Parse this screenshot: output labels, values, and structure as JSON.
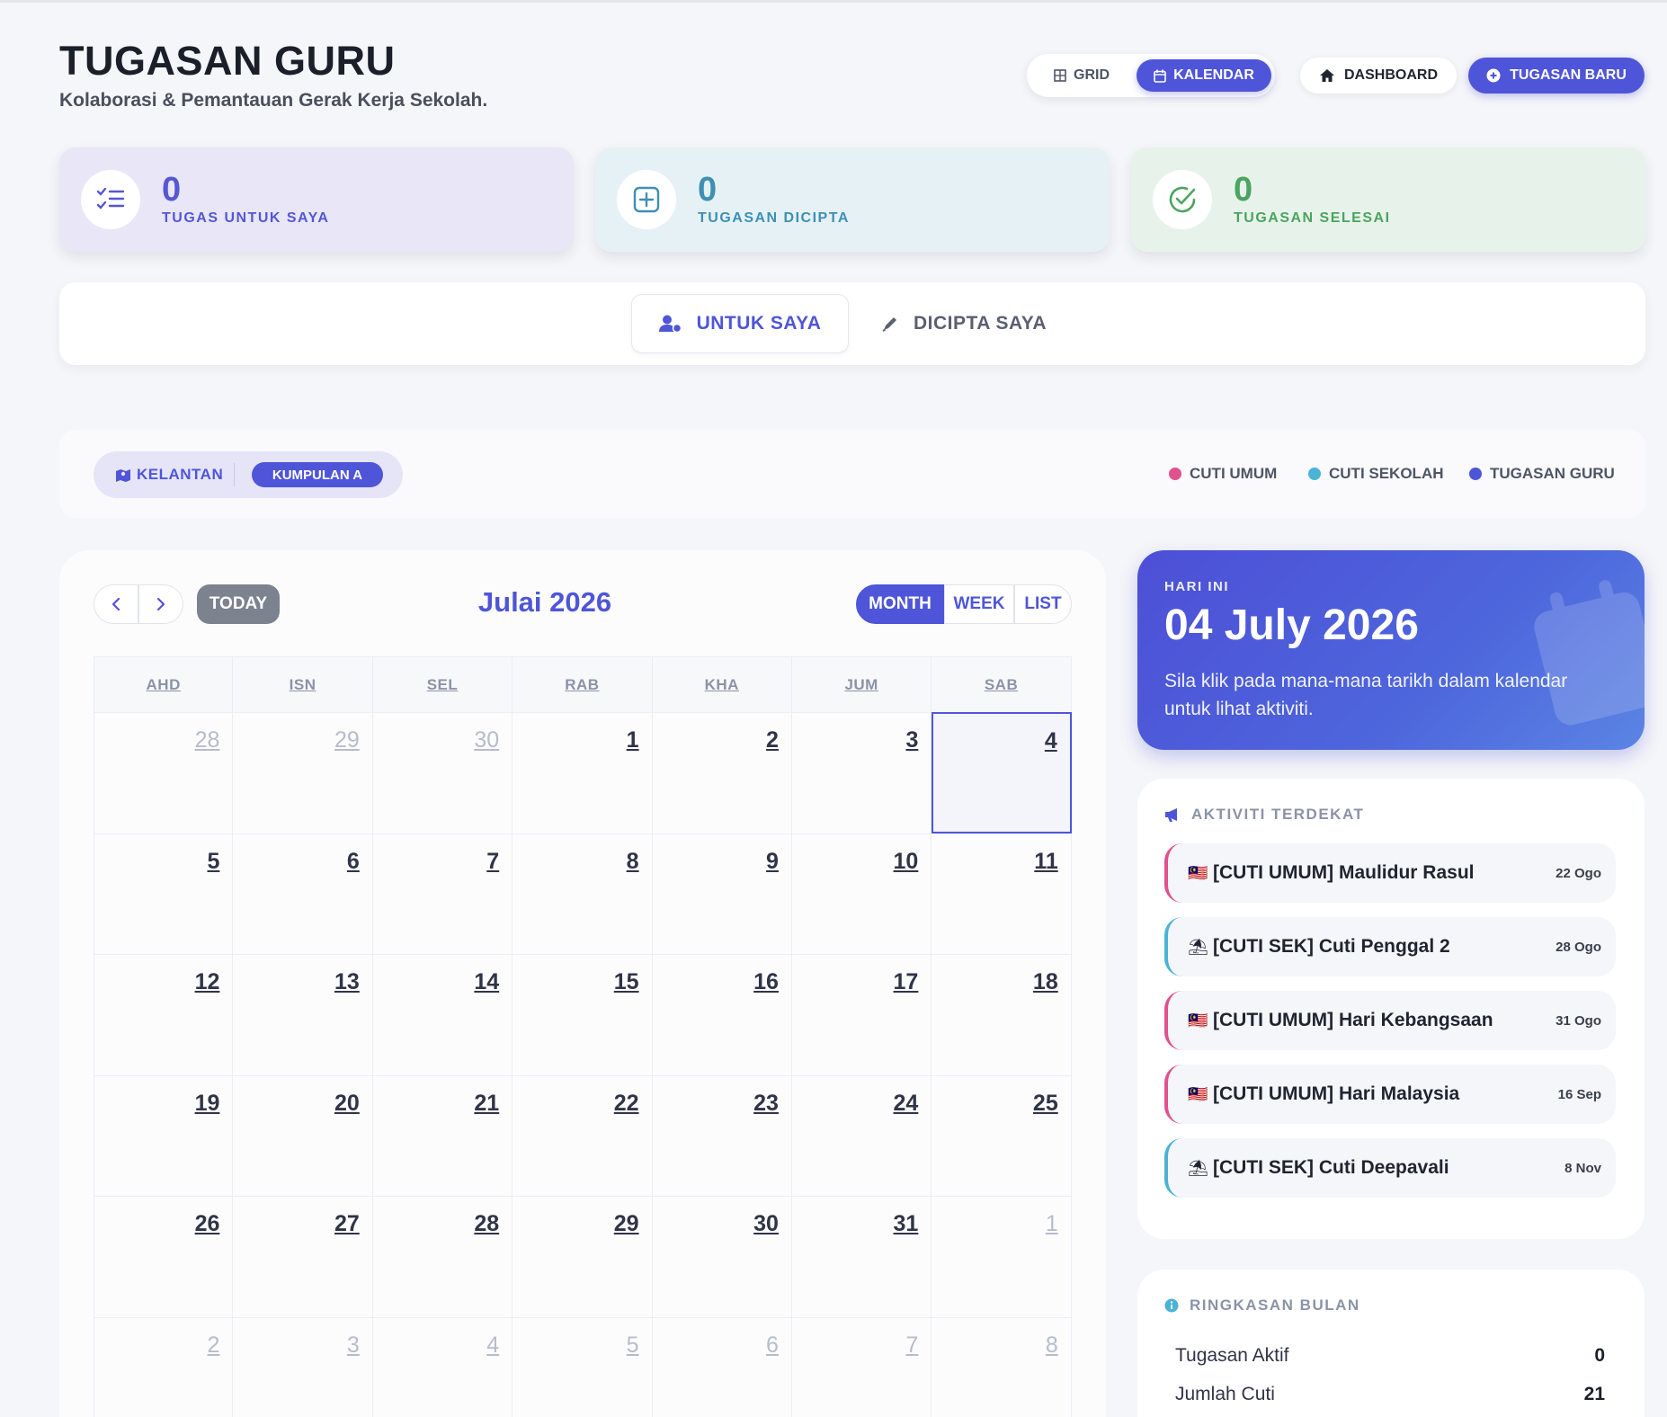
{
  "header": {
    "title": "TUGASAN GURU",
    "subtitle": "Kolaborasi & Pemantauan Gerak Kerja Sekolah.",
    "view_grid": "GRID",
    "view_calendar": "KALENDAR",
    "dashboard": "DASHBOARD",
    "new_task": "TUGASAN BARU"
  },
  "stats": [
    {
      "value": "0",
      "label": "TUGAS UNTUK SAYA",
      "icon": "checklist-icon",
      "color": "#5557d4"
    },
    {
      "value": "0",
      "label": "TUGASAN DICIPTA",
      "icon": "plus-square-icon",
      "color": "#3d90b3"
    },
    {
      "value": "0",
      "label": "TUGASAN SELESAI",
      "icon": "check-circle-icon",
      "color": "#4ba45f"
    }
  ],
  "tabs": [
    {
      "label": "UNTUK SAYA",
      "icon": "user-icon",
      "active": true
    },
    {
      "label": "DICIPTA SAYA",
      "icon": "pen-icon",
      "active": false
    }
  ],
  "filter": {
    "state": "KELANTAN",
    "group": "KUMPULAN A"
  },
  "legend": [
    {
      "label": "CUTI UMUM",
      "color": "#e2508f"
    },
    {
      "label": "CUTI SEKOLAH",
      "color": "#4ab3d6"
    },
    {
      "label": "TUGASAN GURU",
      "color": "#4f55d8"
    }
  ],
  "calendar": {
    "today_button": "TODAY",
    "title": "Julai 2026",
    "views": [
      "MONTH",
      "WEEK",
      "LIST"
    ],
    "weekdays": [
      "AHD",
      "ISN",
      "SEL",
      "RAB",
      "KHA",
      "JUM",
      "SAB"
    ],
    "weeks": [
      [
        {
          "d": "28",
          "o": true
        },
        {
          "d": "29",
          "o": true
        },
        {
          "d": "30",
          "o": true
        },
        {
          "d": "1"
        },
        {
          "d": "2"
        },
        {
          "d": "3"
        },
        {
          "d": "4",
          "t": true
        }
      ],
      [
        {
          "d": "5"
        },
        {
          "d": "6"
        },
        {
          "d": "7"
        },
        {
          "d": "8"
        },
        {
          "d": "9"
        },
        {
          "d": "10"
        },
        {
          "d": "11"
        }
      ],
      [
        {
          "d": "12"
        },
        {
          "d": "13"
        },
        {
          "d": "14"
        },
        {
          "d": "15"
        },
        {
          "d": "16"
        },
        {
          "d": "17"
        },
        {
          "d": "18"
        }
      ],
      [
        {
          "d": "19"
        },
        {
          "d": "20"
        },
        {
          "d": "21"
        },
        {
          "d": "22"
        },
        {
          "d": "23"
        },
        {
          "d": "24"
        },
        {
          "d": "25"
        }
      ],
      [
        {
          "d": "26"
        },
        {
          "d": "27"
        },
        {
          "d": "28"
        },
        {
          "d": "29"
        },
        {
          "d": "30"
        },
        {
          "d": "31"
        },
        {
          "d": "1",
          "o": true
        }
      ],
      [
        {
          "d": "2",
          "o": true
        },
        {
          "d": "3",
          "o": true
        },
        {
          "d": "4",
          "o": true
        },
        {
          "d": "5",
          "o": true
        },
        {
          "d": "6",
          "o": true
        },
        {
          "d": "7",
          "o": true
        },
        {
          "d": "8",
          "o": true
        }
      ]
    ]
  },
  "today_card": {
    "label": "HARI INI",
    "date": "04 July 2026",
    "description": "Sila klik pada mana-mana tarikh dalam kalendar untuk lihat aktiviti."
  },
  "activities": {
    "heading": "AKTIVITI TERDEKAT",
    "items": [
      {
        "title": "[CUTI UMUM] Maulidur Rasul",
        "date": "22 Ogo",
        "type": "umum",
        "icon": "🇲🇾"
      },
      {
        "title": "[CUTI SEK] Cuti Penggal 2",
        "date": "28 Ogo",
        "type": "sek",
        "icon": "⛱"
      },
      {
        "title": "[CUTI UMUM] Hari Kebangsaan",
        "date": "31 Ogo",
        "type": "umum",
        "icon": "🇲🇾"
      },
      {
        "title": "[CUTI UMUM] Hari Malaysia",
        "date": "16 Sep",
        "type": "umum",
        "icon": "🇲🇾"
      },
      {
        "title": "[CUTI SEK] Cuti Deepavali",
        "date": "8 Nov",
        "type": "sek",
        "icon": "⛱"
      }
    ]
  },
  "summary": {
    "heading": "RINGKASAN BULAN",
    "rows": [
      {
        "label": "Tugasan Aktif",
        "value": "0"
      },
      {
        "label": "Jumlah Cuti",
        "value": "21"
      }
    ]
  }
}
